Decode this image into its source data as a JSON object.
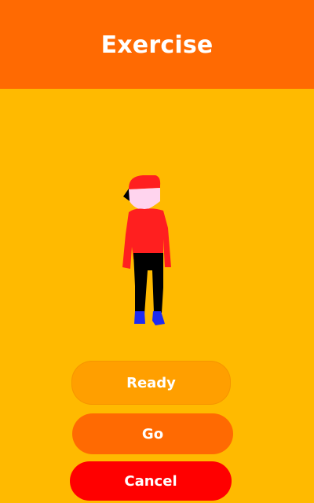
{
  "header": {
    "title": "Exercise"
  },
  "figure": {
    "icon": "person-icon"
  },
  "buttons": {
    "ready_label": "Ready",
    "go_label": "Go",
    "cancel_label": "Cancel"
  },
  "colors": {
    "background": "#ffba00",
    "header": "#ff6a02",
    "ready": "#ff9f00",
    "go": "#ff6a02",
    "cancel": "#ff0000"
  }
}
